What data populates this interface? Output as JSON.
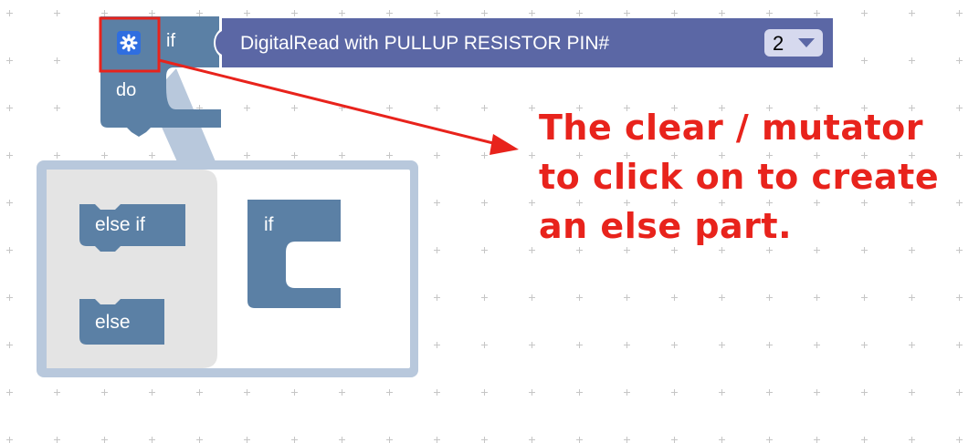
{
  "workspace": {
    "if_block": {
      "if_label": "if",
      "do_label": "do",
      "input_block": {
        "label": "DigitalRead with PULLUP RESISTOR PIN#",
        "pin_value": "2"
      }
    },
    "mutator": {
      "flyout": {
        "else_if_label": "else if",
        "else_label": "else"
      },
      "container": {
        "if_label": "if"
      }
    }
  },
  "annotation": {
    "lines": [
      "The clear / mutator",
      "to click on to create",
      "an else part."
    ]
  },
  "colors": {
    "logic_block": "#5b80a5",
    "io_block": "#5b67a5",
    "highlight_box": "#e8231c",
    "annotation_text": "#e8231c",
    "bubble_border": "#b8c8dc",
    "flyout_bg": "#e4e4e4"
  },
  "icons": {
    "mutator": "gear-icon",
    "dropdown": "triangle-down-icon"
  }
}
